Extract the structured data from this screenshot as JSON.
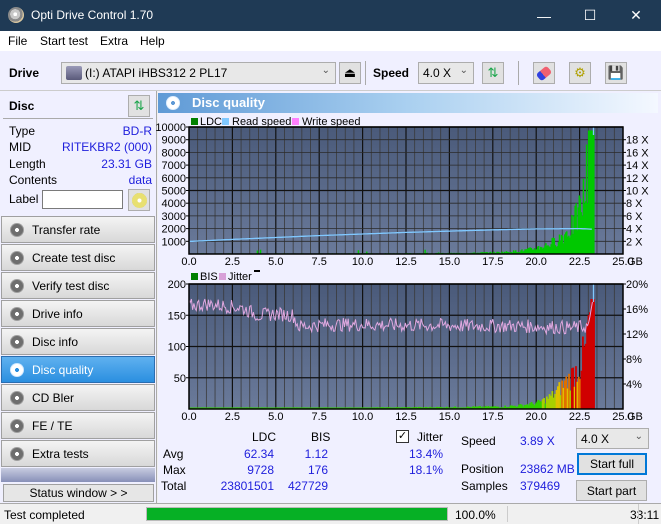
{
  "window": {
    "title": "Opti Drive Control 1.70",
    "minimize": "—",
    "maximize": "☐",
    "close": "✕"
  },
  "menu": [
    "File",
    "Start test",
    "Extra",
    "Help"
  ],
  "toolbar": {
    "drive_label": "Drive",
    "drive_value": "(I:)  ATAPI iHBS312   2 PL17",
    "speed_label": "Speed",
    "speed_value": "4.0 X"
  },
  "disc": {
    "header": "Disc",
    "rows": [
      {
        "key": "Type",
        "value": "BD-R"
      },
      {
        "key": "MID",
        "value": "RITEKBR2 (000)"
      },
      {
        "key": "Length",
        "value": "23.31 GB"
      },
      {
        "key": "Contents",
        "value": "data"
      }
    ],
    "label_key": "Label",
    "label_value": ""
  },
  "nav": [
    {
      "label": "Transfer rate",
      "active": false
    },
    {
      "label": "Create test disc",
      "active": false
    },
    {
      "label": "Verify test disc",
      "active": false
    },
    {
      "label": "Drive info",
      "active": false
    },
    {
      "label": "Disc info",
      "active": false
    },
    {
      "label": "Disc quality",
      "active": true
    },
    {
      "label": "CD Bler",
      "active": false
    },
    {
      "label": "FE / TE",
      "active": false
    },
    {
      "label": "Extra tests",
      "active": false
    }
  ],
  "status_window_label": "Status window > >",
  "panel_title": "Disc quality",
  "chart_data": [
    {
      "type": "bar",
      "title": "LDC / Read speed",
      "legend": [
        "LDC",
        "Read speed",
        "Write speed"
      ],
      "legend_colors": [
        "#008000",
        "#80c8ff",
        "#ff80ff"
      ],
      "x_unit": "GB",
      "xlim": [
        0,
        25
      ],
      "x_ticks": [
        "0.0",
        "2.5",
        "5.0",
        "7.5",
        "10.0",
        "12.5",
        "15.0",
        "17.5",
        "20.0",
        "22.5",
        "25.0"
      ],
      "ylim": [
        0,
        10000
      ],
      "y_ticks": [
        "1000",
        "2000",
        "3000",
        "4000",
        "5000",
        "6000",
        "7000",
        "8000",
        "9000",
        "10000"
      ],
      "y2lim": [
        0,
        20
      ],
      "y2_ticks": [
        "2 X",
        "4 X",
        "6 X",
        "8 X",
        "10 X",
        "12 X",
        "14 X",
        "16 X",
        "18 X"
      ],
      "ldc_profile": {
        "x": [
          0,
          2,
          4,
          6,
          8,
          10,
          12,
          14,
          16,
          18,
          19,
          19.5,
          20,
          20.5,
          21,
          21.5,
          22,
          22.3,
          22.6,
          22.8,
          23.0,
          23.3
        ],
        "y": [
          40,
          40,
          40,
          40,
          40,
          50,
          50,
          60,
          80,
          150,
          250,
          350,
          500,
          700,
          1000,
          1500,
          2200,
          3000,
          4200,
          5200,
          9728,
          9728
        ]
      },
      "read_speed": {
        "x": [
          0,
          2.5,
          5,
          7.5,
          10,
          12.5,
          15,
          17.5,
          20,
          22.5,
          23.3
        ],
        "y": [
          1.98,
          2.3,
          2.6,
          2.9,
          3.15,
          3.4,
          3.6,
          3.8,
          3.95,
          4.0,
          3.9
        ]
      }
    },
    {
      "type": "bar",
      "title": "BIS / Jitter",
      "legend": [
        "BIS",
        "Jitter"
      ],
      "legend_colors": [
        "#008000",
        "#d8a0d8"
      ],
      "x_unit": "GB",
      "xlim": [
        0,
        25
      ],
      "x_ticks": [
        "0.0",
        "2.5",
        "5.0",
        "7.5",
        "10.0",
        "12.5",
        "15.0",
        "17.5",
        "20.0",
        "22.5",
        "25.0"
      ],
      "ylim": [
        0,
        200
      ],
      "y_ticks": [
        "50",
        "100",
        "150",
        "200"
      ],
      "y2lim": [
        0,
        20
      ],
      "y2_ticks": [
        "4%",
        "8%",
        "12%",
        "16%",
        "20%"
      ],
      "bis_profile": {
        "x": [
          0,
          5,
          10,
          15,
          18,
          19,
          20,
          20.5,
          21,
          21.5,
          22,
          22.5,
          22.8,
          23.0,
          23.3
        ],
        "y": [
          2,
          2,
          2,
          3,
          4,
          6,
          10,
          16,
          25,
          40,
          55,
          75,
          100,
          150,
          176
        ]
      },
      "jitter_profile": {
        "x": [
          0,
          1,
          2,
          3,
          4,
          5,
          6,
          6.3,
          8,
          10,
          12,
          14,
          16,
          18,
          20,
          22,
          23,
          23.3
        ],
        "y": [
          16.5,
          16.8,
          16.5,
          16.2,
          15.0,
          15.2,
          15.0,
          13.2,
          13.5,
          13.5,
          13.4,
          13.4,
          13.3,
          13.3,
          13.2,
          13.0,
          13.2,
          18.1
        ]
      }
    }
  ],
  "stats": {
    "col_ldc": "LDC",
    "col_bis": "BIS",
    "jitter_label": "Jitter",
    "jitter_checked": true,
    "rows": [
      {
        "label": "Avg",
        "ldc": "62.34",
        "bis": "1.12",
        "jitter": "13.4%"
      },
      {
        "label": "Max",
        "ldc": "9728",
        "bis": "176",
        "jitter": "18.1%"
      },
      {
        "label": "Total",
        "ldc": "23801501",
        "bis": "427729",
        "jitter": ""
      }
    ],
    "speed_label": "Speed",
    "speed_value": "3.89 X",
    "position_label": "Position",
    "position_value": "23862 MB",
    "samples_label": "Samples",
    "samples_value": "379469",
    "speed_select": "4.0 X",
    "start_full": "Start full",
    "start_part": "Start part"
  },
  "status": {
    "text": "Test completed",
    "progress_percent": 100.0,
    "progress_label": "100.0%",
    "elapsed": "33:11"
  }
}
